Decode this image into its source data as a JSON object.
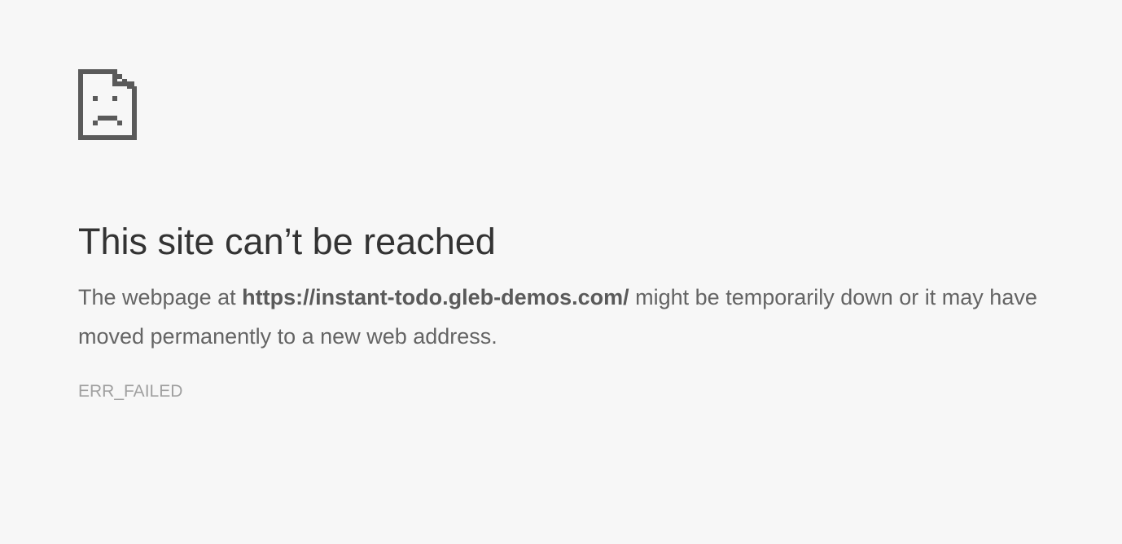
{
  "error": {
    "icon": "sad-page-icon",
    "title": "This site can’t be reached",
    "message_prefix": "The webpage at ",
    "url": "https://instant-todo.gleb-demos.com/",
    "message_suffix": " might be temporarily down or it may have moved permanently to a new web address.",
    "code": "ERR_FAILED"
  },
  "colors": {
    "background": "#f7f7f7",
    "heading": "#333333",
    "body_text": "#646464",
    "error_code": "#a0a0a0",
    "icon": "#5a5a5a"
  }
}
